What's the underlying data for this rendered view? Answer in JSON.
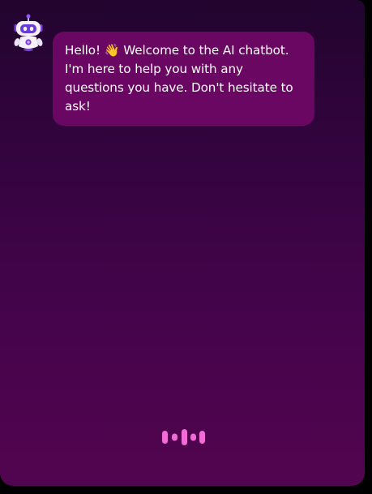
{
  "chat": {
    "greeting": "Hello! 👋 Welcome to the AI chatbot. I'm here to help you with any questions you have. Don't hesitate to ask!"
  },
  "icons": {
    "avatar": "robot-icon",
    "typing": "typing-indicator-icon"
  },
  "colors": {
    "bubble": "#6a0762",
    "background_top": "#22042e",
    "background_bottom": "#52054f",
    "indicator": "#f26bd6",
    "robot_accent": "#7b3fe0"
  }
}
